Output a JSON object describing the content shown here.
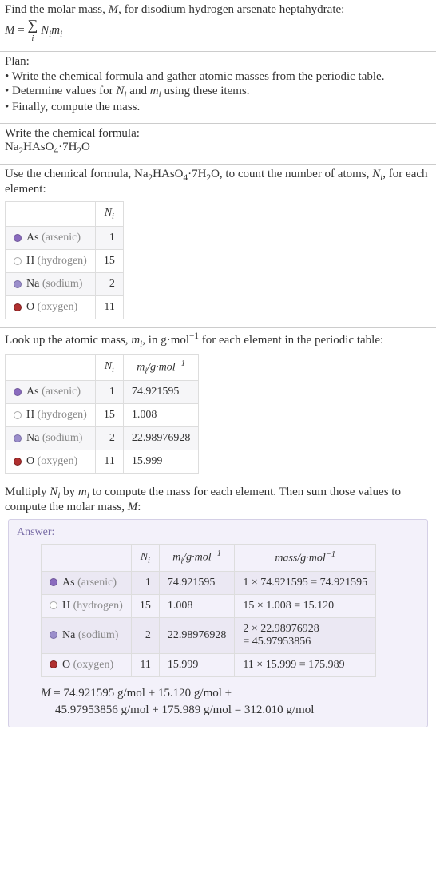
{
  "intro": {
    "line1_pre": "Find the molar mass, ",
    "line1_M": "M",
    "line1_post": ", for disodium hydrogen arsenate heptahydrate:",
    "eq_M": "M",
    "eq_eq": " = ",
    "eq_sum": "∑",
    "eq_sub": "i",
    "eq_Ni": "N",
    "eq_Ni_sub": "i",
    "eq_mi": "m",
    "eq_mi_sub": "i"
  },
  "plan": {
    "heading": "Plan:",
    "b1_pre": "• Write the chemical formula and gather atomic masses from the periodic table.",
    "b2_pre": "• Determine values for ",
    "b2_Ni": "N",
    "b2_Ni_sub": "i",
    "b2_and": " and ",
    "b2_mi": "m",
    "b2_mi_sub": "i",
    "b2_post": " using these items.",
    "b3": "• Finally, compute the mass."
  },
  "write": {
    "heading": "Write the chemical formula:",
    "f_Na": "Na",
    "f_2a": "2",
    "f_HAsO": "HAsO",
    "f_4": "4",
    "f_dot": "·7H",
    "f_2b": "2",
    "f_O": "O"
  },
  "count": {
    "pre": "Use the chemical formula, ",
    "f_Na": "Na",
    "f_2a": "2",
    "f_HAsO": "HAsO",
    "f_4": "4",
    "f_dot": "·7H",
    "f_2b": "2",
    "f_O": "O",
    "mid": ", to count the number of atoms, ",
    "Ni": "N",
    "Ni_sub": "i",
    "post": ", for each element:",
    "col_Ni": "N",
    "col_Ni_sub": "i",
    "rows": {
      "as_name": "As",
      "as_gray": " (arsenic)",
      "as_n": "1",
      "h_name": "H",
      "h_gray": " (hydrogen)",
      "h_n": "15",
      "na_name": "Na",
      "na_gray": " (sodium)",
      "na_n": "2",
      "o_name": "O",
      "o_gray": " (oxygen)",
      "o_n": "11"
    }
  },
  "lookup": {
    "pre": "Look up the atomic mass, ",
    "mi": "m",
    "mi_sub": "i",
    "mid": ", in g·mol",
    "exp": "−1",
    "post": " for each element in the periodic table:",
    "col_Ni": "N",
    "col_Ni_sub": "i",
    "col_mi": "m",
    "col_mi_sub": "i",
    "col_unit": "/g·mol",
    "col_exp": "−1",
    "rows": {
      "as_name": "As",
      "as_gray": " (arsenic)",
      "as_n": "1",
      "as_m": "74.921595",
      "h_name": "H",
      "h_gray": " (hydrogen)",
      "h_n": "15",
      "h_m": "1.008",
      "na_name": "Na",
      "na_gray": " (sodium)",
      "na_n": "2",
      "na_m": "22.98976928",
      "o_name": "O",
      "o_gray": " (oxygen)",
      "o_n": "11",
      "o_m": "15.999"
    }
  },
  "multiply": {
    "pre": "Multiply ",
    "Ni": "N",
    "Ni_sub": "i",
    "by": " by ",
    "mi": "m",
    "mi_sub": "i",
    "post": " to compute the mass for each element. Then sum those values to compute the molar mass, ",
    "M": "M",
    "colon": ":"
  },
  "answer": {
    "label": "Answer:",
    "col_Ni": "N",
    "col_Ni_sub": "i",
    "col_mi": "m",
    "col_mi_sub": "i",
    "col_unit": "/g·mol",
    "col_exp": "−1",
    "col_mass": "mass/g·mol",
    "col_mass_exp": "−1",
    "rows": {
      "as_name": "As",
      "as_gray": " (arsenic)",
      "as_n": "1",
      "as_m": "74.921595",
      "as_mass": "1 × 74.921595 = 74.921595",
      "h_name": "H",
      "h_gray": " (hydrogen)",
      "h_n": "15",
      "h_m": "1.008",
      "h_mass": "15 × 1.008 = 15.120",
      "na_name": "Na",
      "na_gray": " (sodium)",
      "na_n": "2",
      "na_m": "22.98976928",
      "na_mass_l1": "2 × 22.98976928",
      "na_mass_l2": "= 45.97953856",
      "o_name": "O",
      "o_gray": " (oxygen)",
      "o_n": "11",
      "o_m": "15.999",
      "o_mass": "11 × 15.999 = 175.989"
    },
    "final_l1_M": "M",
    "final_l1_rest": " = 74.921595 g/mol + 15.120 g/mol + ",
    "final_l2": "45.97953856 g/mol + 175.989 g/mol = 312.010 g/mol"
  }
}
